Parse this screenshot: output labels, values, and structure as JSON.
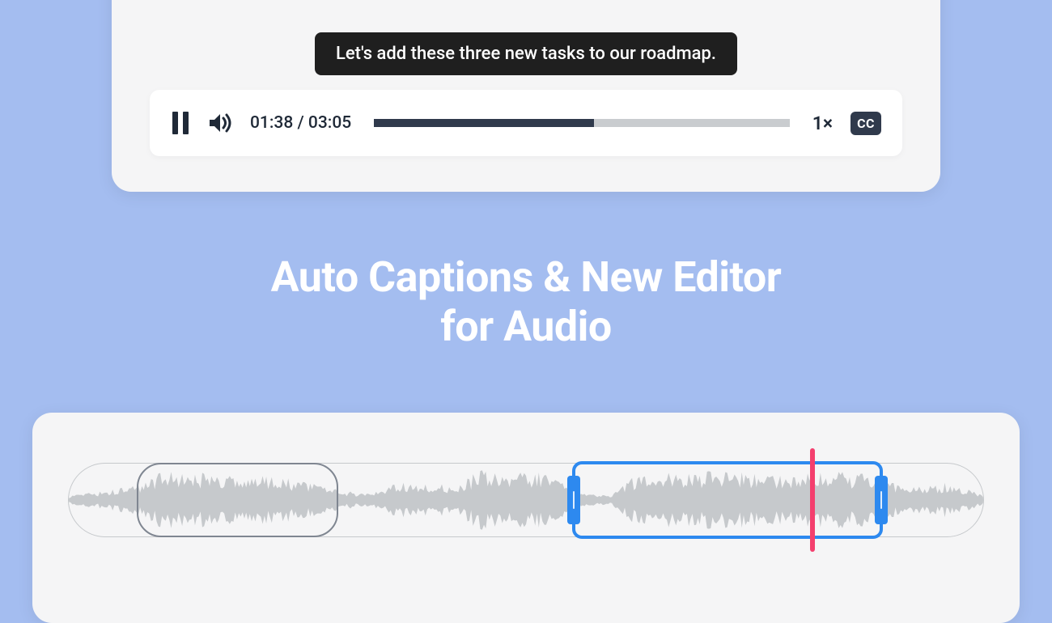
{
  "caption": "Let's add these three new tasks to our roadmap.",
  "player": {
    "current_time": "01:38",
    "total_time": "03:05",
    "separator": " / ",
    "progress_percent": 53,
    "speed_label": "1×",
    "cc_label": "CC"
  },
  "headline_line1": "Auto Captions & New Editor",
  "headline_line2": "for Audio",
  "editor": {
    "gray_region": {
      "left_pct": 7.5,
      "width_pct": 22
    },
    "blue_region": {
      "left_pct": 55,
      "width_pct": 34
    },
    "playhead_pct": 81
  }
}
